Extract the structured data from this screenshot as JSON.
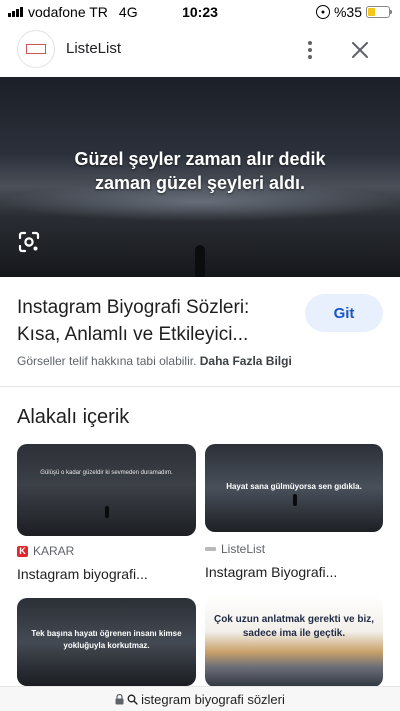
{
  "status_bar": {
    "carrier": "vodafone TR",
    "network": "4G",
    "time": "10:23",
    "battery": "%35",
    "battery_level": 0.35
  },
  "header": {
    "site_name": "ListeList",
    "favicon_icon": "listelist-logo",
    "more_icon": "more-vert-icon",
    "close_icon": "close-icon"
  },
  "hero": {
    "quote": "Güzel şeyler zaman alır dedik zaman güzel şeyleri aldı.",
    "lens_icon": "google-lens-icon"
  },
  "result": {
    "title": "Instagram Biyografi Sözleri: Kısa, Anlamlı ve Etkileyici...",
    "go_label": "Git",
    "copyright_text": "Görseller telif hakkına tabi olabilir.",
    "more_info_label": "Daha Fazla Bilgi"
  },
  "related": {
    "heading": "Alakalı içerik",
    "cards": [
      {
        "image_text": "Gülüşü o kadar güzeldir ki sevmeden duramadım.",
        "source": "KARAR",
        "title": "Instagram biyografi..."
      },
      {
        "image_text": "Hayat sana gülmüyorsa sen gıdıkla.",
        "source": "ListeList",
        "title": "Instagram Biyografi..."
      },
      {
        "image_text": "Tek başına hayatı öğrenen insanı kimse yokluğuyla korkutmaz.",
        "source": "",
        "title": ""
      },
      {
        "image_text": "Çok uzun anlatmak gerekti ve biz, sadece ima ile geçtik.",
        "source": "",
        "title": ""
      }
    ]
  },
  "url_bar": {
    "lock_icon": "lock-icon",
    "search_icon": "search-icon",
    "text": "istegram biyografi sözleri"
  },
  "colors": {
    "accent_button_bg": "#e8f0fe",
    "accent_button_text": "#1a56c2",
    "karar_brand": "#e3262b",
    "battery_fill": "#f5c518"
  }
}
